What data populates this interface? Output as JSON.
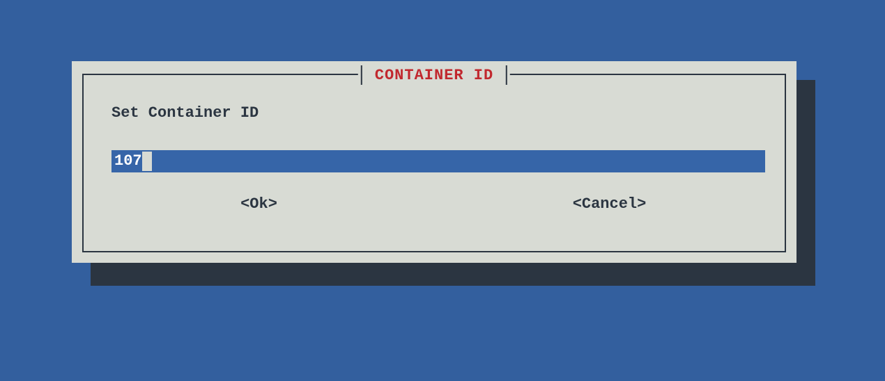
{
  "dialog": {
    "title": "CONTAINER ID",
    "prompt": "Set Container ID",
    "input_value": "107",
    "ok_label": "<Ok>",
    "cancel_label": "<Cancel>"
  },
  "colors": {
    "background": "#335f9e",
    "panel": "#d8dbd4",
    "shadow": "#2b3541",
    "input_bg": "#3665a8",
    "title": "#c1282e"
  }
}
